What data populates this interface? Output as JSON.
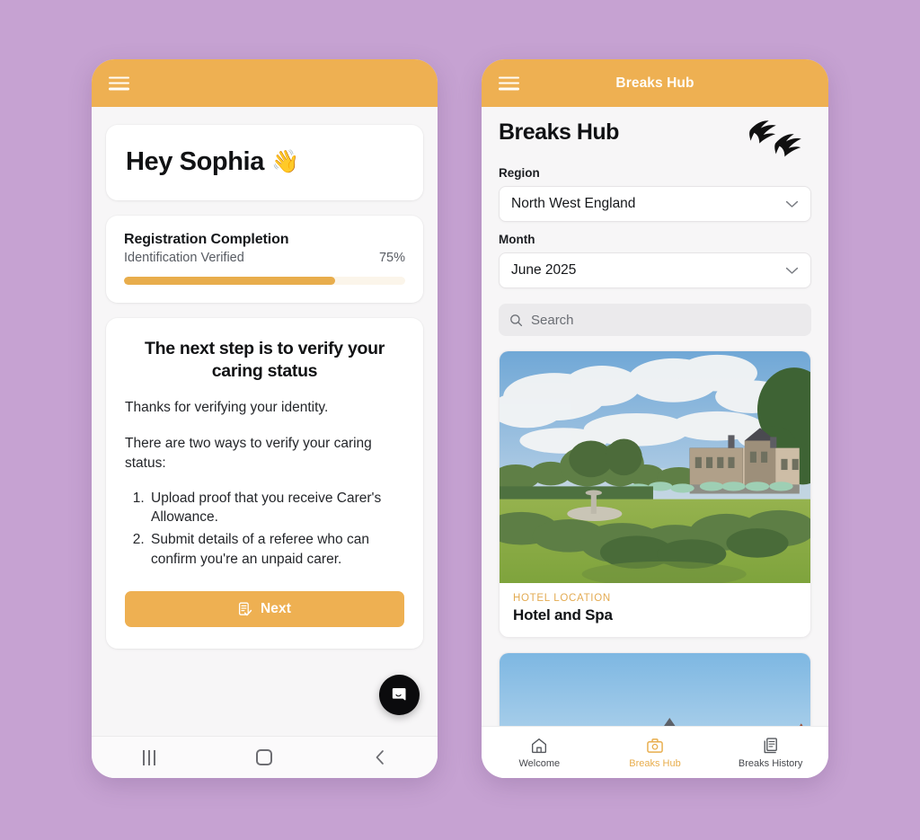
{
  "background_color": "#c6a2d2",
  "accent_color": "#eeb052",
  "left_phone": {
    "appbar": {
      "menu_icon": "hamburger-menu-icon",
      "title": ""
    },
    "greeting": {
      "text": "Hey Sophia",
      "emoji": "👋"
    },
    "progress_card": {
      "title": "Registration Completion",
      "subtitle": "Identification Verified",
      "percent_label": "75%",
      "percent_value": 75
    },
    "step_card": {
      "title": "The next step is to verify your caring status",
      "paragraph_1": "Thanks for verifying your identity.",
      "paragraph_2": "There are two ways to verify your caring status:",
      "list": [
        "Upload proof that you receive Carer's Allowance.",
        "Submit details of a referee who can confirm you're an unpaid carer."
      ],
      "button_label": "Next",
      "button_icon": "document-check-icon"
    },
    "chat_widget": {
      "icon": "chat-bubble-icon"
    },
    "android_nav": {
      "recents": "recents-icon",
      "home": "home-icon",
      "back": "back-icon"
    }
  },
  "right_phone": {
    "appbar": {
      "menu_icon": "hamburger-menu-icon",
      "title": "Breaks Hub"
    },
    "page_title": "Breaks Hub",
    "logo": "flying-birds-icon",
    "region": {
      "label": "Region",
      "value": "North West England",
      "chevron": "chevron-down-icon"
    },
    "month": {
      "label": "Month",
      "value": "June 2025",
      "chevron": "chevron-down-icon"
    },
    "search": {
      "placeholder": "Search",
      "icon": "search-icon"
    },
    "listings": [
      {
        "kicker": "HOTEL LOCATION",
        "name": "Hotel and Spa"
      },
      {
        "kicker": "",
        "name": ""
      }
    ],
    "bottom_nav": [
      {
        "label": "Welcome",
        "icon": "home-outline-icon",
        "active": false
      },
      {
        "label": "Breaks Hub",
        "icon": "suitcase-icon",
        "active": true
      },
      {
        "label": "Breaks History",
        "icon": "archive-document-icon",
        "active": false
      }
    ]
  }
}
